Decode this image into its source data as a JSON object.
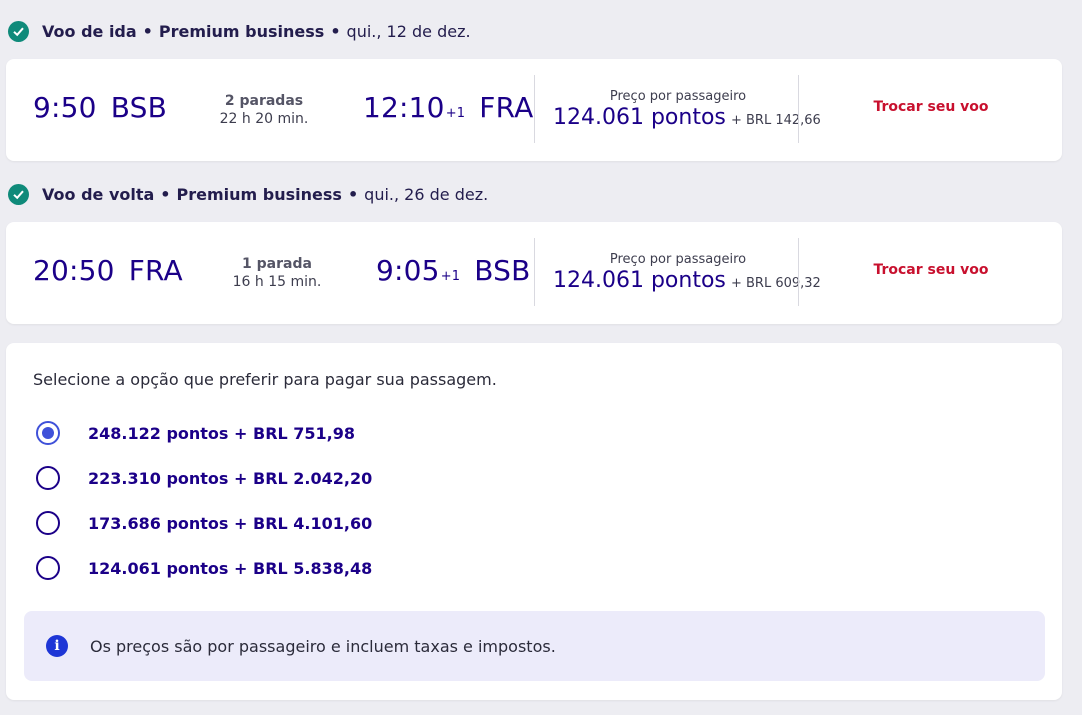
{
  "outbound": {
    "header": {
      "trip": "Voo de ida",
      "cabin": "Premium business",
      "date": "qui., 12 de dez."
    },
    "dep_time": "9:50",
    "dep_code": "BSB",
    "stops": "2 paradas",
    "duration": "22 h 20 min.",
    "arr_time": "12:10",
    "arr_plus": "+1",
    "arr_code": "FRA",
    "price_label": "Preço por passageiro",
    "points": "124.061 pontos",
    "brl": "+ BRL 142,66",
    "change_label": "Trocar seu voo"
  },
  "return": {
    "header": {
      "trip": "Voo de volta",
      "cabin": "Premium business",
      "date": "qui., 26 de dez."
    },
    "dep_time": "20:50",
    "dep_code": "FRA",
    "stops": "1 parada",
    "duration": "16 h 15 min.",
    "arr_time": "9:05",
    "arr_plus": "+1",
    "arr_code": "BSB",
    "price_label": "Preço por passageiro",
    "points": "124.061 pontos",
    "brl": "+ BRL 609,32",
    "change_label": "Trocar seu voo"
  },
  "payment": {
    "title": "Selecione a opção que preferir para pagar sua passagem.",
    "options": [
      {
        "label": "248.122 pontos + BRL 751,98",
        "selected": true
      },
      {
        "label": "223.310 pontos + BRL 2.042,20",
        "selected": false
      },
      {
        "label": "173.686 pontos + BRL 4.101,60",
        "selected": false
      },
      {
        "label": "124.061 pontos + BRL 5.838,48",
        "selected": false
      }
    ],
    "info": "Os preços são por passageiro e incluem taxas e impostos."
  },
  "colors": {
    "brand": "#1b0088",
    "accent": "#c8102e",
    "check": "#0f8a7a",
    "radio": "#3f51d9"
  }
}
